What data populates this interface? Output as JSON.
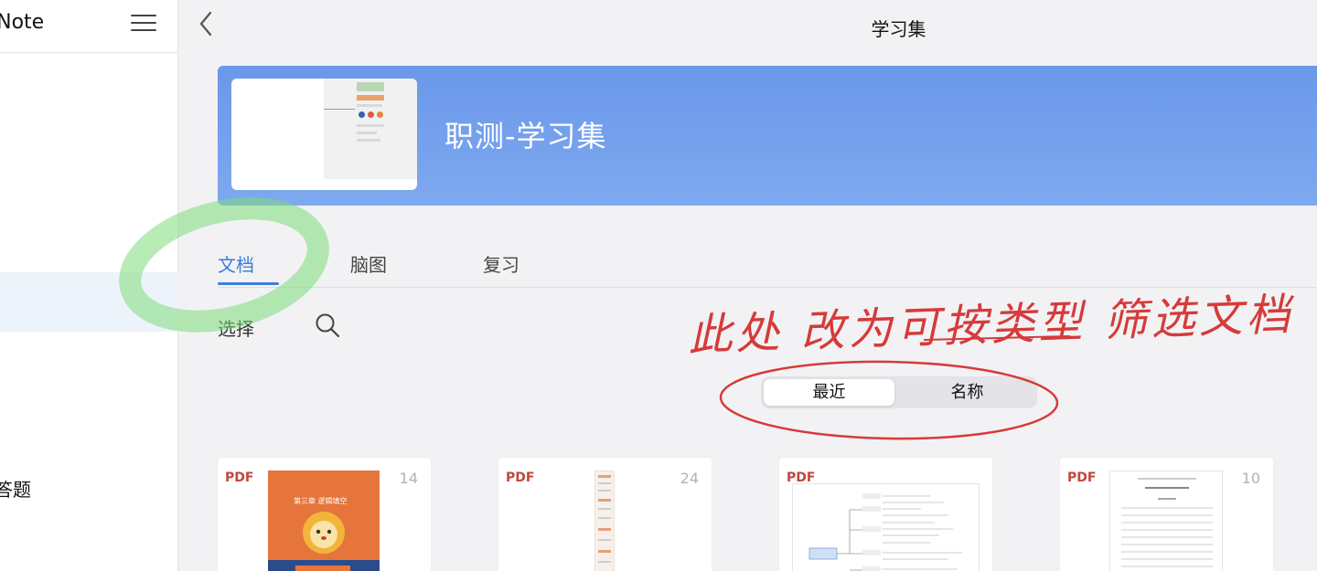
{
  "sidebar": {
    "app_title": "iNote",
    "partial_item": "答题"
  },
  "header": {
    "title": "学习集"
  },
  "banner": {
    "title": "职测-学习集"
  },
  "tabs": [
    {
      "label": "文档",
      "active": true
    },
    {
      "label": "脑图",
      "active": false
    },
    {
      "label": "复习",
      "active": false
    }
  ],
  "toolbar": {
    "select_label": "选择"
  },
  "sort": {
    "options": [
      "最近",
      "名称"
    ],
    "selected": "最近"
  },
  "documents": [
    {
      "type": "PDF",
      "pages": "14",
      "thumb_title": "第三章 逻辑填空"
    },
    {
      "type": "PDF",
      "pages": "24"
    },
    {
      "type": "PDF",
      "pages": ""
    },
    {
      "type": "PDF",
      "pages": "10"
    }
  ],
  "annotation": {
    "text": "此处 改为可按类型 筛选文档",
    "color": "#d63a3a",
    "highlight_color": "#7ddc7a"
  },
  "colors": {
    "accent": "#3d7fd8",
    "banner": "#6a97ea",
    "pdf_badge": "#c0473c"
  }
}
